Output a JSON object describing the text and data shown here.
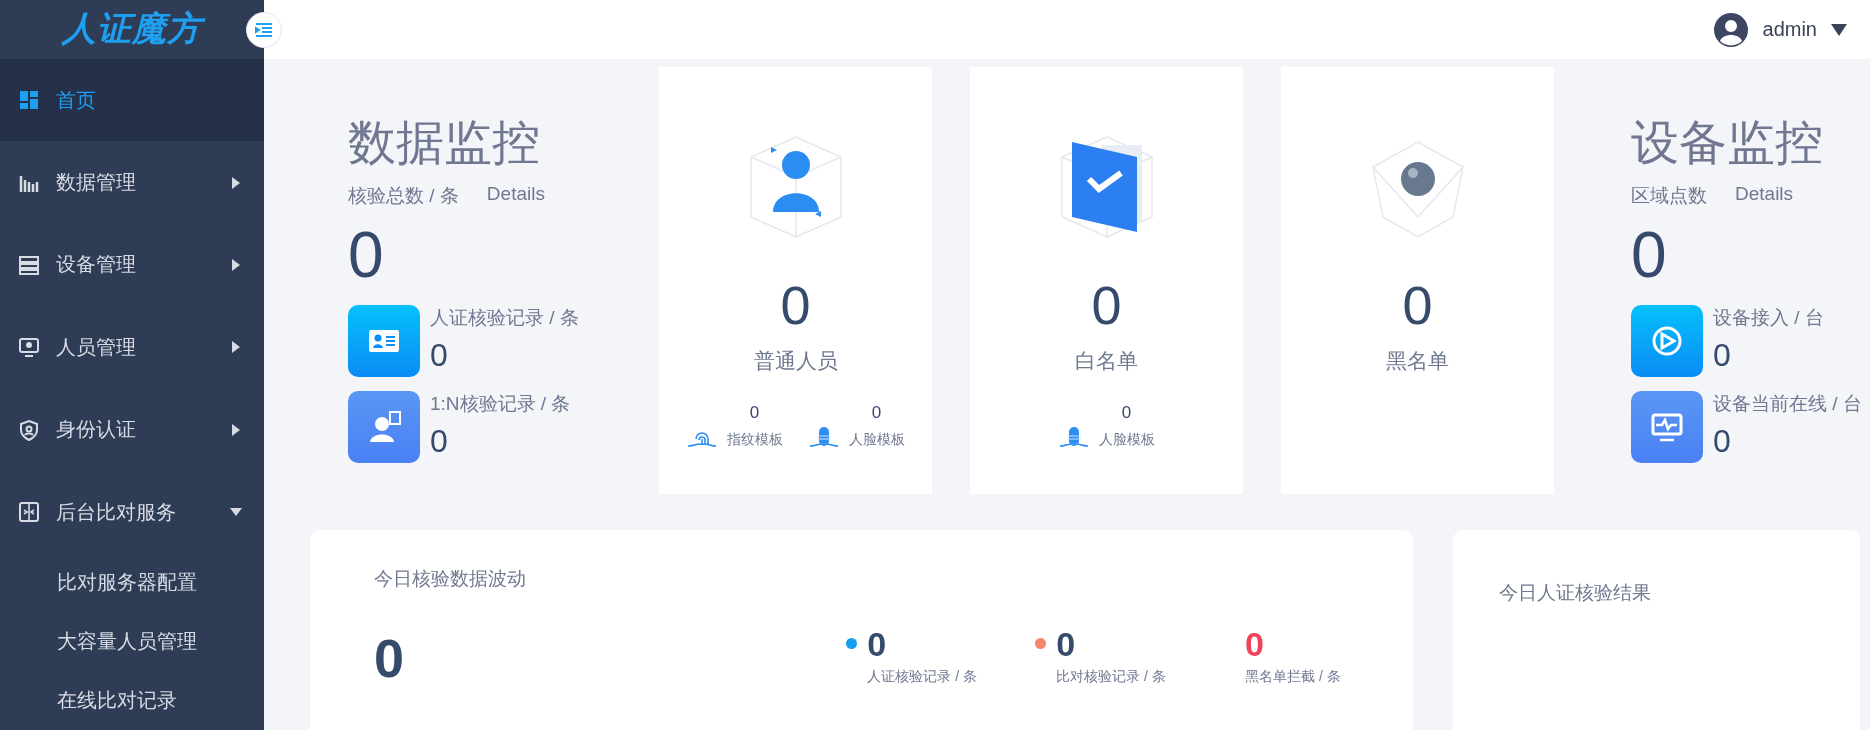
{
  "header": {
    "user": "admin"
  },
  "sidebar": {
    "logo": "人证魔方",
    "items": [
      {
        "label": "首页",
        "kind": "link",
        "selected": true
      },
      {
        "label": "数据管理",
        "kind": "menu",
        "selected": false,
        "expanded": false
      },
      {
        "label": "设备管理",
        "kind": "menu",
        "selected": false,
        "expanded": false
      },
      {
        "label": "人员管理",
        "kind": "menu",
        "selected": false,
        "expanded": false
      },
      {
        "label": "身份认证",
        "kind": "menu",
        "selected": false,
        "expanded": false
      },
      {
        "label": "后台比对服务",
        "kind": "menu",
        "selected": false,
        "expanded": true,
        "children": [
          {
            "label": "比对服务器配置"
          },
          {
            "label": "大容量人员管理"
          },
          {
            "label": "在线比对记录"
          }
        ]
      }
    ]
  },
  "data_monitor": {
    "title": "数据监控",
    "total_label": "核验总数 / 条",
    "details": "Details",
    "total": "0",
    "stats": [
      {
        "label": "人证核验记录 / 条",
        "value": "0"
      },
      {
        "label": "1:N核验记录 / 条",
        "value": "0"
      }
    ]
  },
  "cards": [
    {
      "value": "0",
      "label": "普通人员",
      "templates": [
        {
          "kind": "fingerprint",
          "value": "0",
          "label": "指纹模板"
        },
        {
          "kind": "face",
          "value": "0",
          "label": "人脸模板"
        }
      ]
    },
    {
      "value": "0",
      "label": "白名单",
      "templates": [
        {
          "kind": "face",
          "value": "0",
          "label": "人脸模板"
        }
      ]
    },
    {
      "value": "0",
      "label": "黑名单"
    }
  ],
  "device_monitor": {
    "title": "设备监控",
    "total_label": "区域点数",
    "details": "Details",
    "total": "0",
    "stats": [
      {
        "label": "设备接入 / 台",
        "value": "0"
      },
      {
        "label": "设备当前在线 / 台",
        "value": "0"
      }
    ]
  },
  "trend": {
    "title": "今日核验数据波动",
    "total": "0",
    "legend": [
      {
        "kind": "dot",
        "color": "#129ff2",
        "value": "0",
        "label": "人证核验记录 / 条"
      },
      {
        "kind": "dot",
        "color": "#f2876a",
        "value": "0",
        "label": "比对核验记录 / 条"
      },
      {
        "kind": "alert",
        "value": "0",
        "label": "黑名单拦截 / 条"
      }
    ]
  },
  "results": {
    "title": "今日人证核验结果"
  }
}
